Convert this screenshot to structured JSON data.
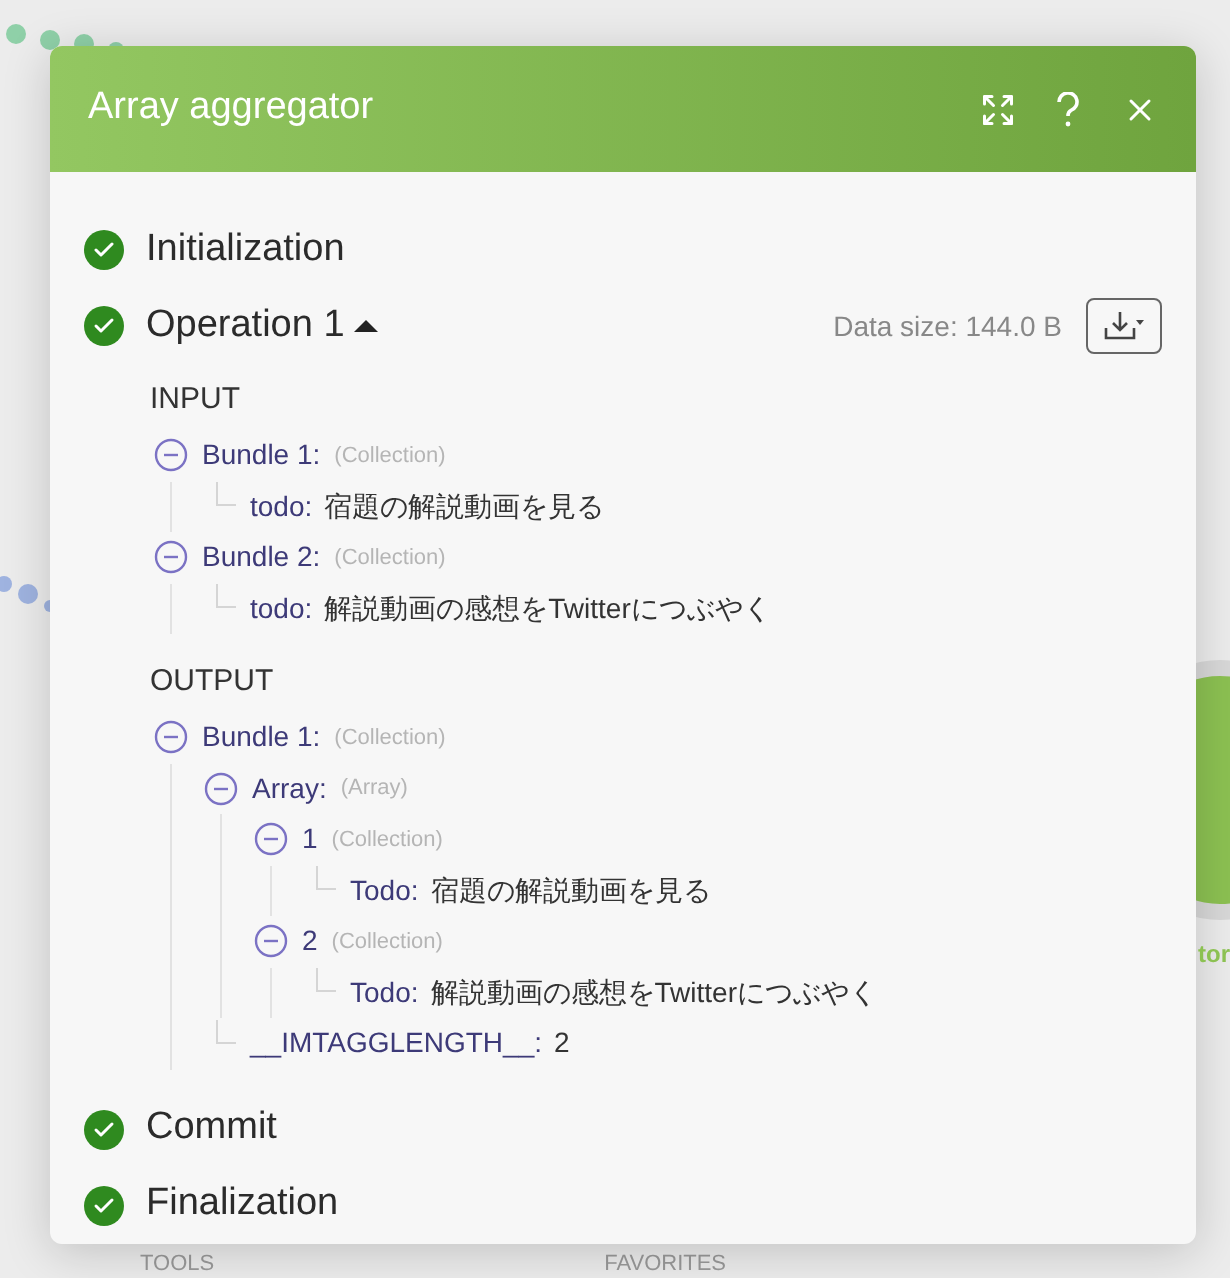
{
  "canvas": {
    "node_label": "tor",
    "footer_tabs": [
      "TOOLS",
      "FAVORITES"
    ]
  },
  "dialog": {
    "title": "Array aggregator",
    "steps": [
      {
        "label": "Initialization",
        "completed": true
      },
      {
        "label": "Operation 1",
        "completed": true,
        "expanded": true,
        "data_size": "Data size: 144.0 B",
        "sections": [
          {
            "label": "INPUT",
            "items": [
              {
                "key": "Bundle 1:",
                "type": "(Collection)",
                "expanded": true,
                "children": [
                  {
                    "key": "todo:",
                    "value": "宿題の解説動画を見る"
                  }
                ]
              },
              {
                "key": "Bundle 2:",
                "type": "(Collection)",
                "expanded": true,
                "children": [
                  {
                    "key": "todo:",
                    "value": "解説動画の感想をTwitterにつぶやく"
                  }
                ]
              }
            ]
          },
          {
            "label": "OUTPUT",
            "items": [
              {
                "key": "Bundle 1:",
                "type": "(Collection)",
                "expanded": true,
                "children": [
                  {
                    "key": "Array:",
                    "type": "(Array)",
                    "expanded": true,
                    "children": [
                      {
                        "key": "1",
                        "type": "(Collection)",
                        "expanded": true,
                        "children": [
                          {
                            "key": "Todo:",
                            "value": "宿題の解説動画を見る"
                          }
                        ]
                      },
                      {
                        "key": "2",
                        "type": "(Collection)",
                        "expanded": true,
                        "children": [
                          {
                            "key": "Todo:",
                            "value": "解説動画の感想をTwitterにつぶやく"
                          }
                        ]
                      }
                    ]
                  },
                  {
                    "key": "__IMTAGGLENGTH__:",
                    "value": "2"
                  }
                ]
              }
            ]
          }
        ]
      },
      {
        "label": "Commit",
        "completed": true
      },
      {
        "label": "Finalization",
        "completed": true
      }
    ]
  }
}
